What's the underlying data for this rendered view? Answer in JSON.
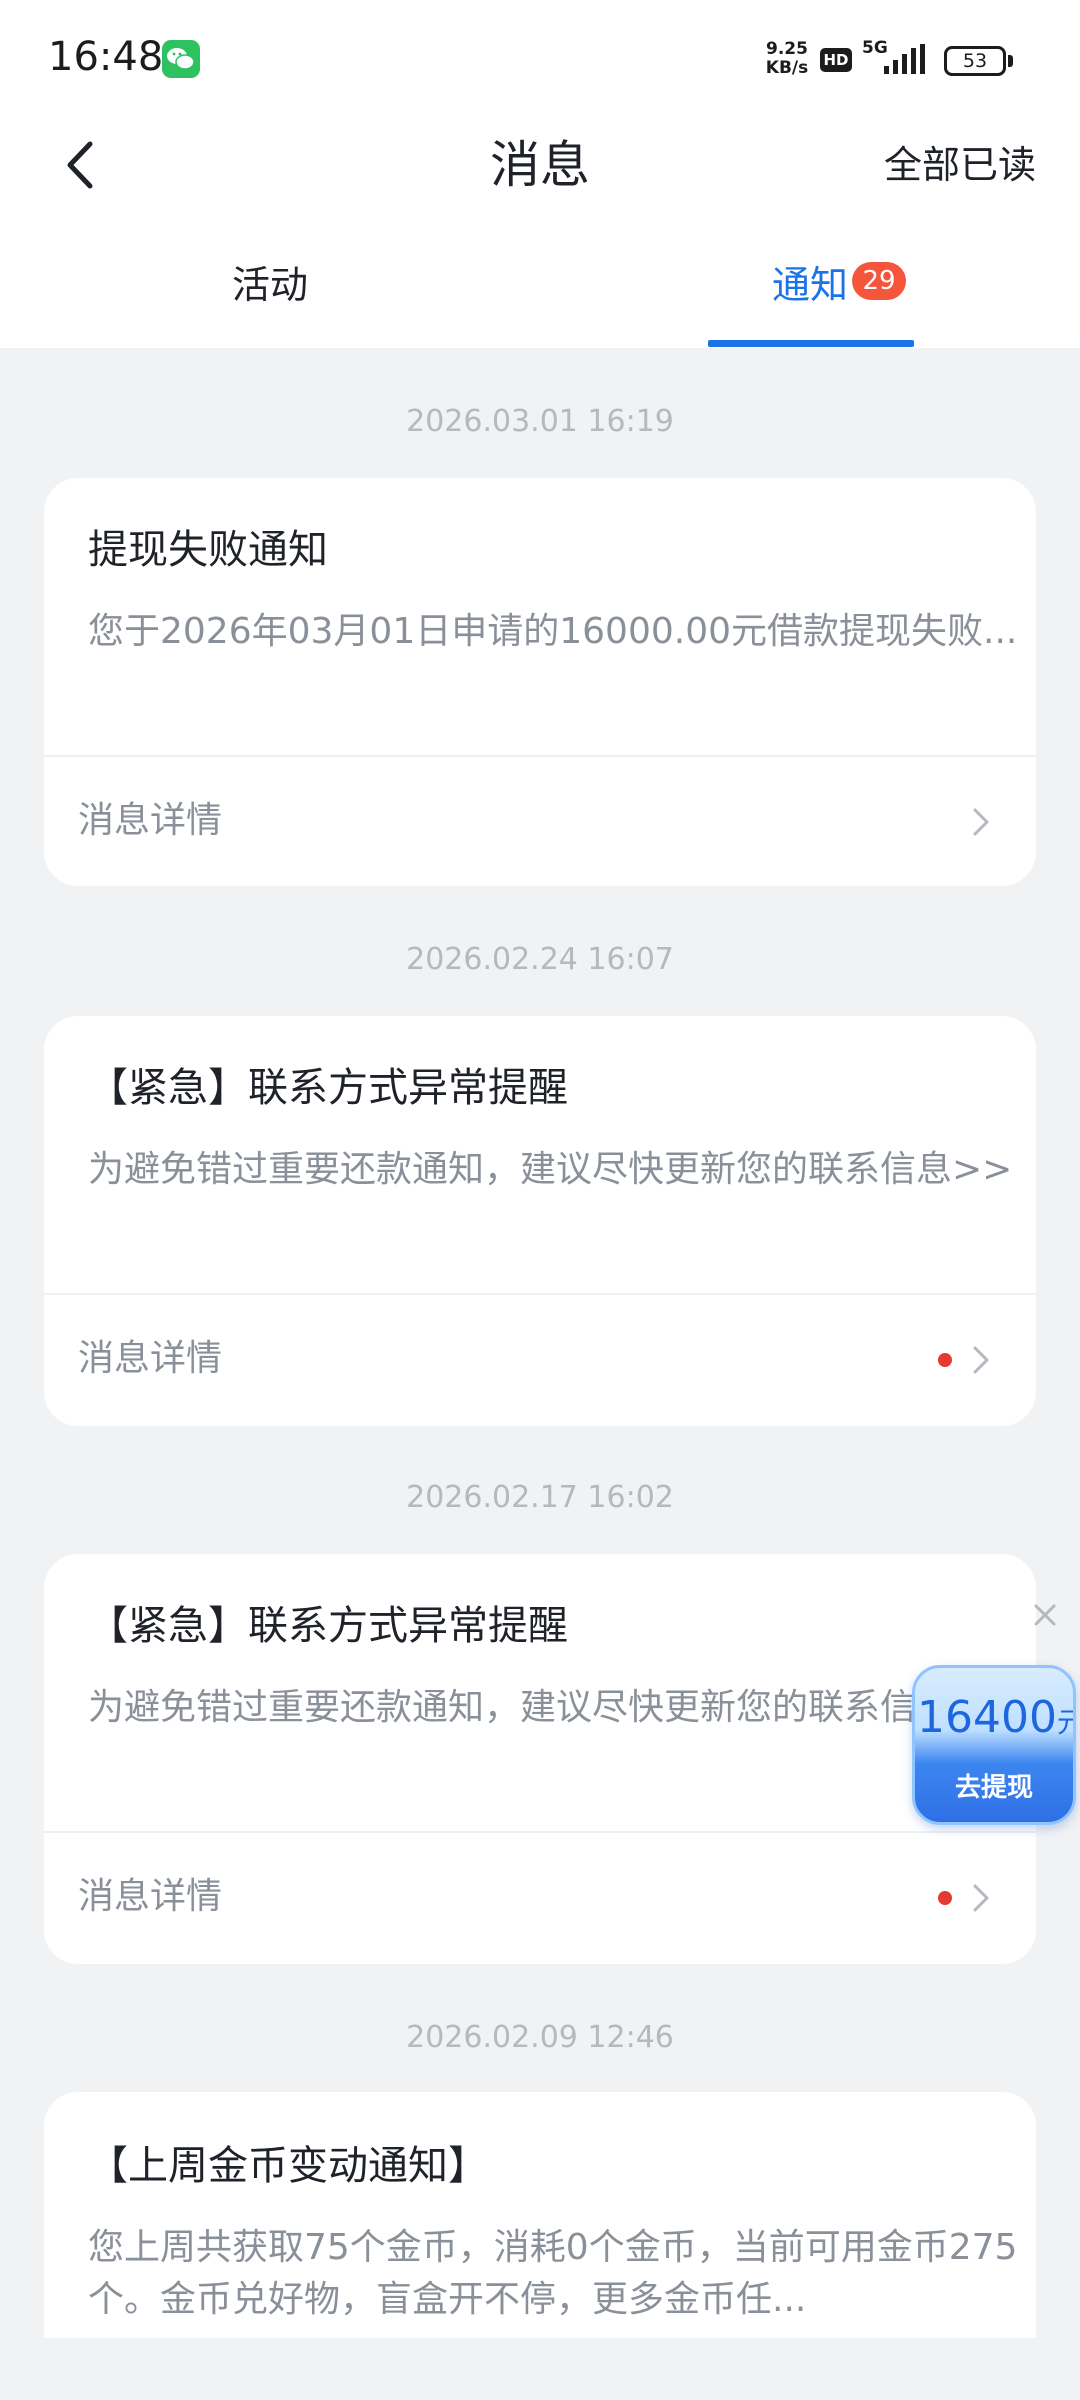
{
  "status_bar": {
    "time": "16:48",
    "net_speed_value": "9.25",
    "net_speed_unit": "KB/s",
    "hd": "HD",
    "network": "5G",
    "battery": "53",
    "icons": [
      "wechat-icon",
      "signal-icon",
      "battery-icon"
    ]
  },
  "header": {
    "title": "消息",
    "mark_all_read": "全部已读"
  },
  "tabs": [
    {
      "label": "活动",
      "active": false
    },
    {
      "label": "通知",
      "active": true,
      "badge": "29"
    }
  ],
  "messages": [
    {
      "time": "2026.03.01 16:19",
      "title": "提现失败通知",
      "body": "您于2026年03月01日申请的16000.00元借款提现失败...",
      "link": "消息详情",
      "unread": false
    },
    {
      "time": "2026.02.24 16:07",
      "title": "【紧急】联系方式异常提醒",
      "body": "为避免错过重要还款通知，建议尽快更新您的联系信息>>",
      "link": "消息详情",
      "unread": true
    },
    {
      "time": "2026.02.17 16:02",
      "title": "【紧急】联系方式异常提醒",
      "body": "为避免错过重要还款通知，建议尽快更新您的联系信息>>",
      "link": "消息详情",
      "unread": true
    },
    {
      "time": "2026.02.09 12:46",
      "title": "【上周金币变动通知】",
      "body": "您上周共获取75个金币，消耗0个金币，当前可用金币275个。金币兑好物，盲盒开不停，更多金币任...",
      "link": "",
      "unread": false
    }
  ],
  "float_widget": {
    "amount": "16400",
    "unit": "元",
    "action": "去提现"
  },
  "colors": {
    "accent": "#1a73e8",
    "badge": "#f5553b",
    "unread_dot": "#e53a2f",
    "background": "#f1f2f4"
  }
}
